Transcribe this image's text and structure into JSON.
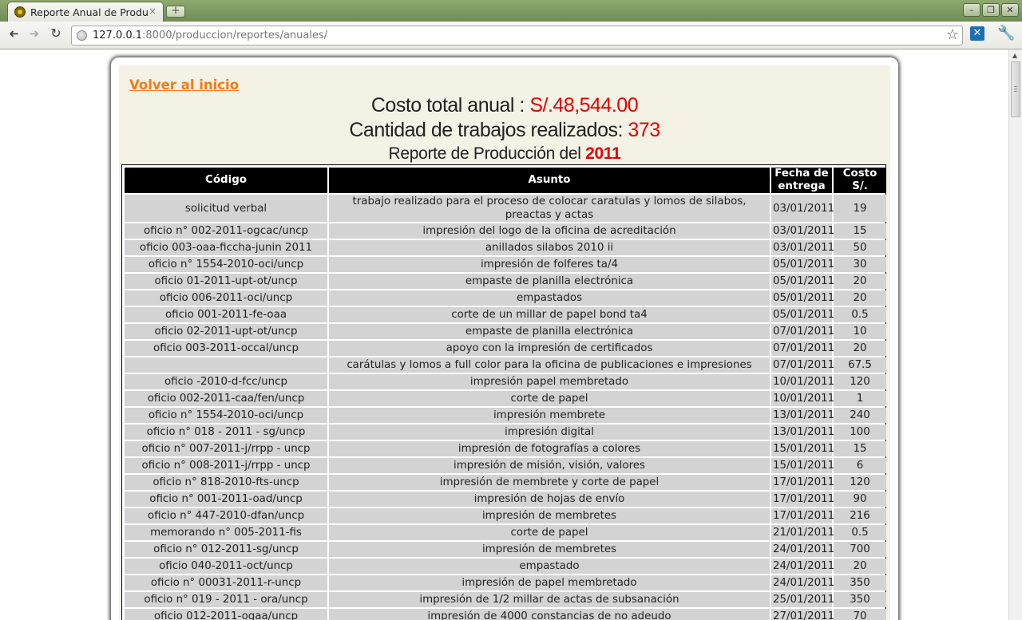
{
  "browser": {
    "tab_title": "Reporte Anual de Produ",
    "tab_close": "×",
    "new_tab": "+",
    "url_host": "127.0.0.1",
    "url_path": ":8000/produccion/reportes/anuales/",
    "controls": {
      "minimize": "–",
      "restore": "❐",
      "close": "✕"
    },
    "nav": {
      "back": "➜",
      "forward": "➜",
      "reload": "↻",
      "star": "☆",
      "wrench": "🔧"
    }
  },
  "page": {
    "back_link": "Volver al inicio",
    "total_cost_label": "Costo total anual : ",
    "total_cost_value": "S/.48,544.00",
    "jobs_label": "Cantidad de trabajos realizados: ",
    "jobs_value": "373",
    "report_label": "Reporte de Producción del ",
    "report_year": "2011"
  },
  "table": {
    "headers": [
      "Código",
      "Asunto",
      "Fecha de entrega",
      "Costo S/."
    ],
    "rows": [
      [
        "solicitud verbal",
        "trabajo realizado para el proceso de colocar caratulas y lomos de silabos, preactas y actas",
        "03/01/2011",
        "19"
      ],
      [
        "oficio n° 002-2011-ogcac/uncp",
        "impresión del logo de la oficina de acreditación",
        "03/01/2011",
        "15"
      ],
      [
        "oficio 003-oaa-ficcha-junin 2011",
        "anillados silabos 2010 ii",
        "03/01/2011",
        "50"
      ],
      [
        "oficio n° 1554-2010-oci/uncp",
        "impresión de folferes ta/4",
        "05/01/2011",
        "30"
      ],
      [
        "oficio 01-2011-upt-ot/uncp",
        "empaste de planilla electrónica",
        "05/01/2011",
        "20"
      ],
      [
        "oficio 006-2011-oci/uncp",
        "empastados",
        "05/01/2011",
        "20"
      ],
      [
        "oficio 001-2011-fe-oaa",
        "corte de un millar de papel bond ta4",
        "05/01/2011",
        "0.5"
      ],
      [
        "oficio 02-2011-upt-ot/uncp",
        "empaste de planilla electrónica",
        "07/01/2011",
        "10"
      ],
      [
        "oficio 003-2011-occal/uncp",
        "apoyo con la impresión de certificados",
        "07/01/2011",
        "20"
      ],
      [
        "",
        "carátulas y lomos a full color para la oficina de publicaciones e impresiones",
        "07/01/2011",
        "67.5"
      ],
      [
        "oficio -2010-d-fcc/uncp",
        "impresión papel membretado",
        "10/01/2011",
        "120"
      ],
      [
        "oficio 002-2011-caa/fen/uncp",
        "corte de papel",
        "10/01/2011",
        "1"
      ],
      [
        "oficio n° 1554-2010-oci/uncp",
        "impresión membrete",
        "13/01/2011",
        "240"
      ],
      [
        "oficio n° 018 - 2011 - sg/uncp",
        "impresión digital",
        "13/01/2011",
        "100"
      ],
      [
        "oficio n° 007-2011-j/rrpp - uncp",
        "impresión de fotografías a colores",
        "15/01/2011",
        "15"
      ],
      [
        "oficio n° 008-2011-j/rrpp - uncp",
        "impresión de misión, visión, valores",
        "15/01/2011",
        "6"
      ],
      [
        "oficio n° 818-2010-fts-uncp",
        "impresión de membrete y corte de papel",
        "17/01/2011",
        "120"
      ],
      [
        "oficio n° 001-2011-oad/uncp",
        "impresión de hojas de envío",
        "17/01/2011",
        "90"
      ],
      [
        "oficio n° 447-2010-dfan/uncp",
        "impresión de membretes",
        "17/01/2011",
        "216"
      ],
      [
        "memorando n° 005-2011-fis",
        "corte de papel",
        "21/01/2011",
        "0.5"
      ],
      [
        "oficio n° 012-2011-sg/uncp",
        "impresión de membretes",
        "24/01/2011",
        "700"
      ],
      [
        "oficio 040-2011-oct/uncp",
        "empastado",
        "24/01/2011",
        "20"
      ],
      [
        "oficio n° 00031-2011-r-uncp",
        "impresión de papel membretado",
        "24/01/2011",
        "350"
      ],
      [
        "oficio n° 019 - 2011 - ora/uncp",
        "impresión de 1/2 millar de actas de subsanación",
        "25/01/2011",
        "350"
      ],
      [
        "oficio 012-2011-ogaa/uncp",
        "impresión de 4000 constancias de no adeudo",
        "27/01/2011",
        "70"
      ]
    ]
  }
}
